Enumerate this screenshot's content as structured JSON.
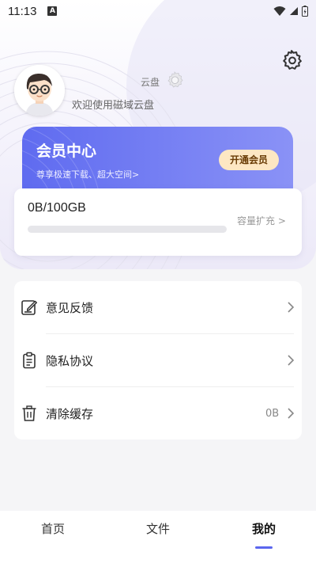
{
  "status_bar": {
    "time": "11:13",
    "notification_icon_letter": "A",
    "icons": [
      "wifi-icon",
      "signal-icon",
      "battery-icon"
    ]
  },
  "profile": {
    "username": "云盘",
    "welcome": "欢迎使用磁域云盘"
  },
  "vip": {
    "title": "会员中心",
    "subtitle": "尊享极速下载、超大空间>",
    "button": "开通会员",
    "gradient_from": "#5f6bf0",
    "gradient_to": "#8a92f6"
  },
  "storage": {
    "used_text": "0B/100GB",
    "used_fraction": 0,
    "expand_link": "容量扩充 >"
  },
  "menu": [
    {
      "label": "意见反馈",
      "value": "",
      "icon": "feedback-edit-icon"
    },
    {
      "label": "隐私协议",
      "value": "",
      "icon": "clipboard-icon"
    },
    {
      "label": "清除缓存",
      "value": "0B",
      "icon": "trash-icon"
    }
  ],
  "tabs": [
    {
      "label": "首页",
      "active": false
    },
    {
      "label": "文件",
      "active": false
    },
    {
      "label": "我的",
      "active": true
    }
  ],
  "colors": {
    "accent": "#5b66ee",
    "vip_button_bg": "#fde7c3",
    "vip_button_text": "#6a3d06"
  }
}
